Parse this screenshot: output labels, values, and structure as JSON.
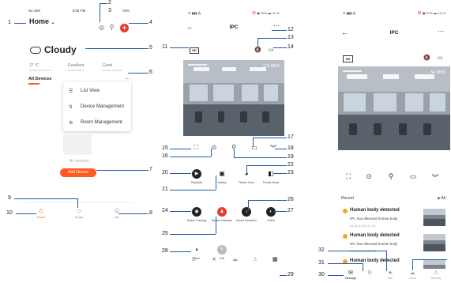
{
  "colors": {
    "accent": "#ff5a1f",
    "alert": "#e63b2e",
    "callout": "#1f5aa6",
    "event_dot": "#f5a623"
  },
  "phone1": {
    "status": {
      "carrier": "No SIM",
      "time": "0:05 PM",
      "battery": "78%"
    },
    "title": "Home",
    "title_icon": "chevron-down-icon",
    "header_icons": [
      "camera-icon",
      "mic-icon"
    ],
    "add_icon": "plus-icon",
    "weather": {
      "icon": "cloud-icon",
      "label": "Cloudy"
    },
    "metrics": [
      {
        "value": "27 °C",
        "label": "Outdoor Temperature"
      },
      {
        "value": "Excellent",
        "label": "Outdoor PM2.5"
      },
      {
        "value": "Good",
        "label": "Outdoor Air Quality"
      }
    ],
    "tab": "All Devices",
    "more_icon": "more-dots-icon",
    "menu": [
      {
        "icon": "list-icon",
        "label": "List View"
      },
      {
        "icon": "sort-icon",
        "label": "Device Management"
      },
      {
        "icon": "gear-icon",
        "label": "Room Management"
      }
    ],
    "empty_text": "No devices",
    "add_device": "Add Device",
    "nav": [
      {
        "icon": "home-icon",
        "label": "Home",
        "active": true
      },
      {
        "icon": "sun-icon",
        "label": "Smart",
        "active": false
      },
      {
        "icon": "user-icon",
        "label": "Me",
        "active": false
      }
    ]
  },
  "phone2": {
    "status": {
      "left": "☰ ▮▮▮ ⁂",
      "right": "⏰ ▣ 99% ▬ 21:11"
    },
    "title": "IPC",
    "back_icon": "back-arrow-icon",
    "more_icon": "more-dots-icon",
    "hd_label": "HD",
    "mute_icon": "speaker-mute-icon",
    "fullscreen_icon": "screen-icon",
    "speed": "173 KB/S",
    "controls": [
      "screenshot-frame-icon",
      "camera-icon",
      "mic-icon",
      "video-record-icon",
      "expand-chevron-icon"
    ],
    "features": [
      {
        "icon": "play-icon",
        "label": "Playback",
        "style": "dark"
      },
      {
        "icon": "image-icon",
        "label": "Gallery",
        "style": "plain"
      },
      {
        "icon": "palette-icon",
        "label": "Theme Color",
        "style": "plain"
      },
      {
        "icon": "privacy-icon",
        "label": "Private Mode",
        "style": "plain"
      },
      {
        "icon": "motion-icon",
        "label": "Motion Tracking",
        "style": "dark"
      },
      {
        "icon": "run-icon",
        "label": "Motion Detection",
        "style": "red"
      },
      {
        "icon": "sound-icon",
        "label": "Sound Detection",
        "style": "dark"
      },
      {
        "icon": "patrol-icon",
        "label": "Patrol",
        "style": "dark"
      },
      {
        "icon": "siren-icon",
        "label": "Siren",
        "style": "plain"
      },
      {
        "icon": "edit-icon",
        "label": "Edit",
        "style": "grey"
      }
    ],
    "bottom_icons": [
      "settings-icon",
      "star-icon",
      "cloud-icon",
      "alert-icon",
      "grid-icon"
    ]
  },
  "phone3": {
    "status": {
      "left": "☰ ▮▮▮ ⁂",
      "right": "⏰ ▣ 97% ▬ 21:13"
    },
    "title": "IPC",
    "back_icon": "back-arrow-icon",
    "more_icon": "more-dots-icon",
    "hd_label": "HD",
    "mute_icon": "speaker-mute-icon",
    "fullscreen_icon": "screen-icon",
    "speed": "54 KB/S",
    "controls": [
      "screenshot-frame-icon",
      "camera-icon",
      "mic-icon",
      "video-record-icon",
      "expand-chevron-icon"
    ],
    "recent": "Recent",
    "all": "All",
    "events": [
      {
        "title": "Human body detected",
        "desc": "IPC has detected human body",
        "time": "21-04-12 20:27:41"
      },
      {
        "title": "Human body detected",
        "desc": "IPC has detected human body",
        "time": "21-04-12 20:24:32"
      },
      {
        "title": "Human body detected",
        "desc": "",
        "time": ""
      }
    ],
    "nav": [
      {
        "icon": "message-icon",
        "label": "Message",
        "active": true
      },
      {
        "icon": "settings-icon",
        "label": "",
        "active": false
      },
      {
        "icon": "star-icon",
        "label": "Star",
        "active": false
      },
      {
        "icon": "cloud-icon",
        "label": "Cloud",
        "active": false
      },
      {
        "icon": "alert-icon",
        "label": "Security",
        "active": false
      }
    ]
  },
  "callouts": [
    "1",
    "2",
    "3",
    "4",
    "5",
    "6",
    "7",
    "8",
    "9",
    "10",
    "11",
    "12",
    "13",
    "14",
    "15",
    "16",
    "17",
    "18",
    "19",
    "20",
    "21",
    "22",
    "23",
    "24",
    "25",
    "26",
    "27",
    "28",
    "29",
    "30",
    "31",
    "32"
  ]
}
